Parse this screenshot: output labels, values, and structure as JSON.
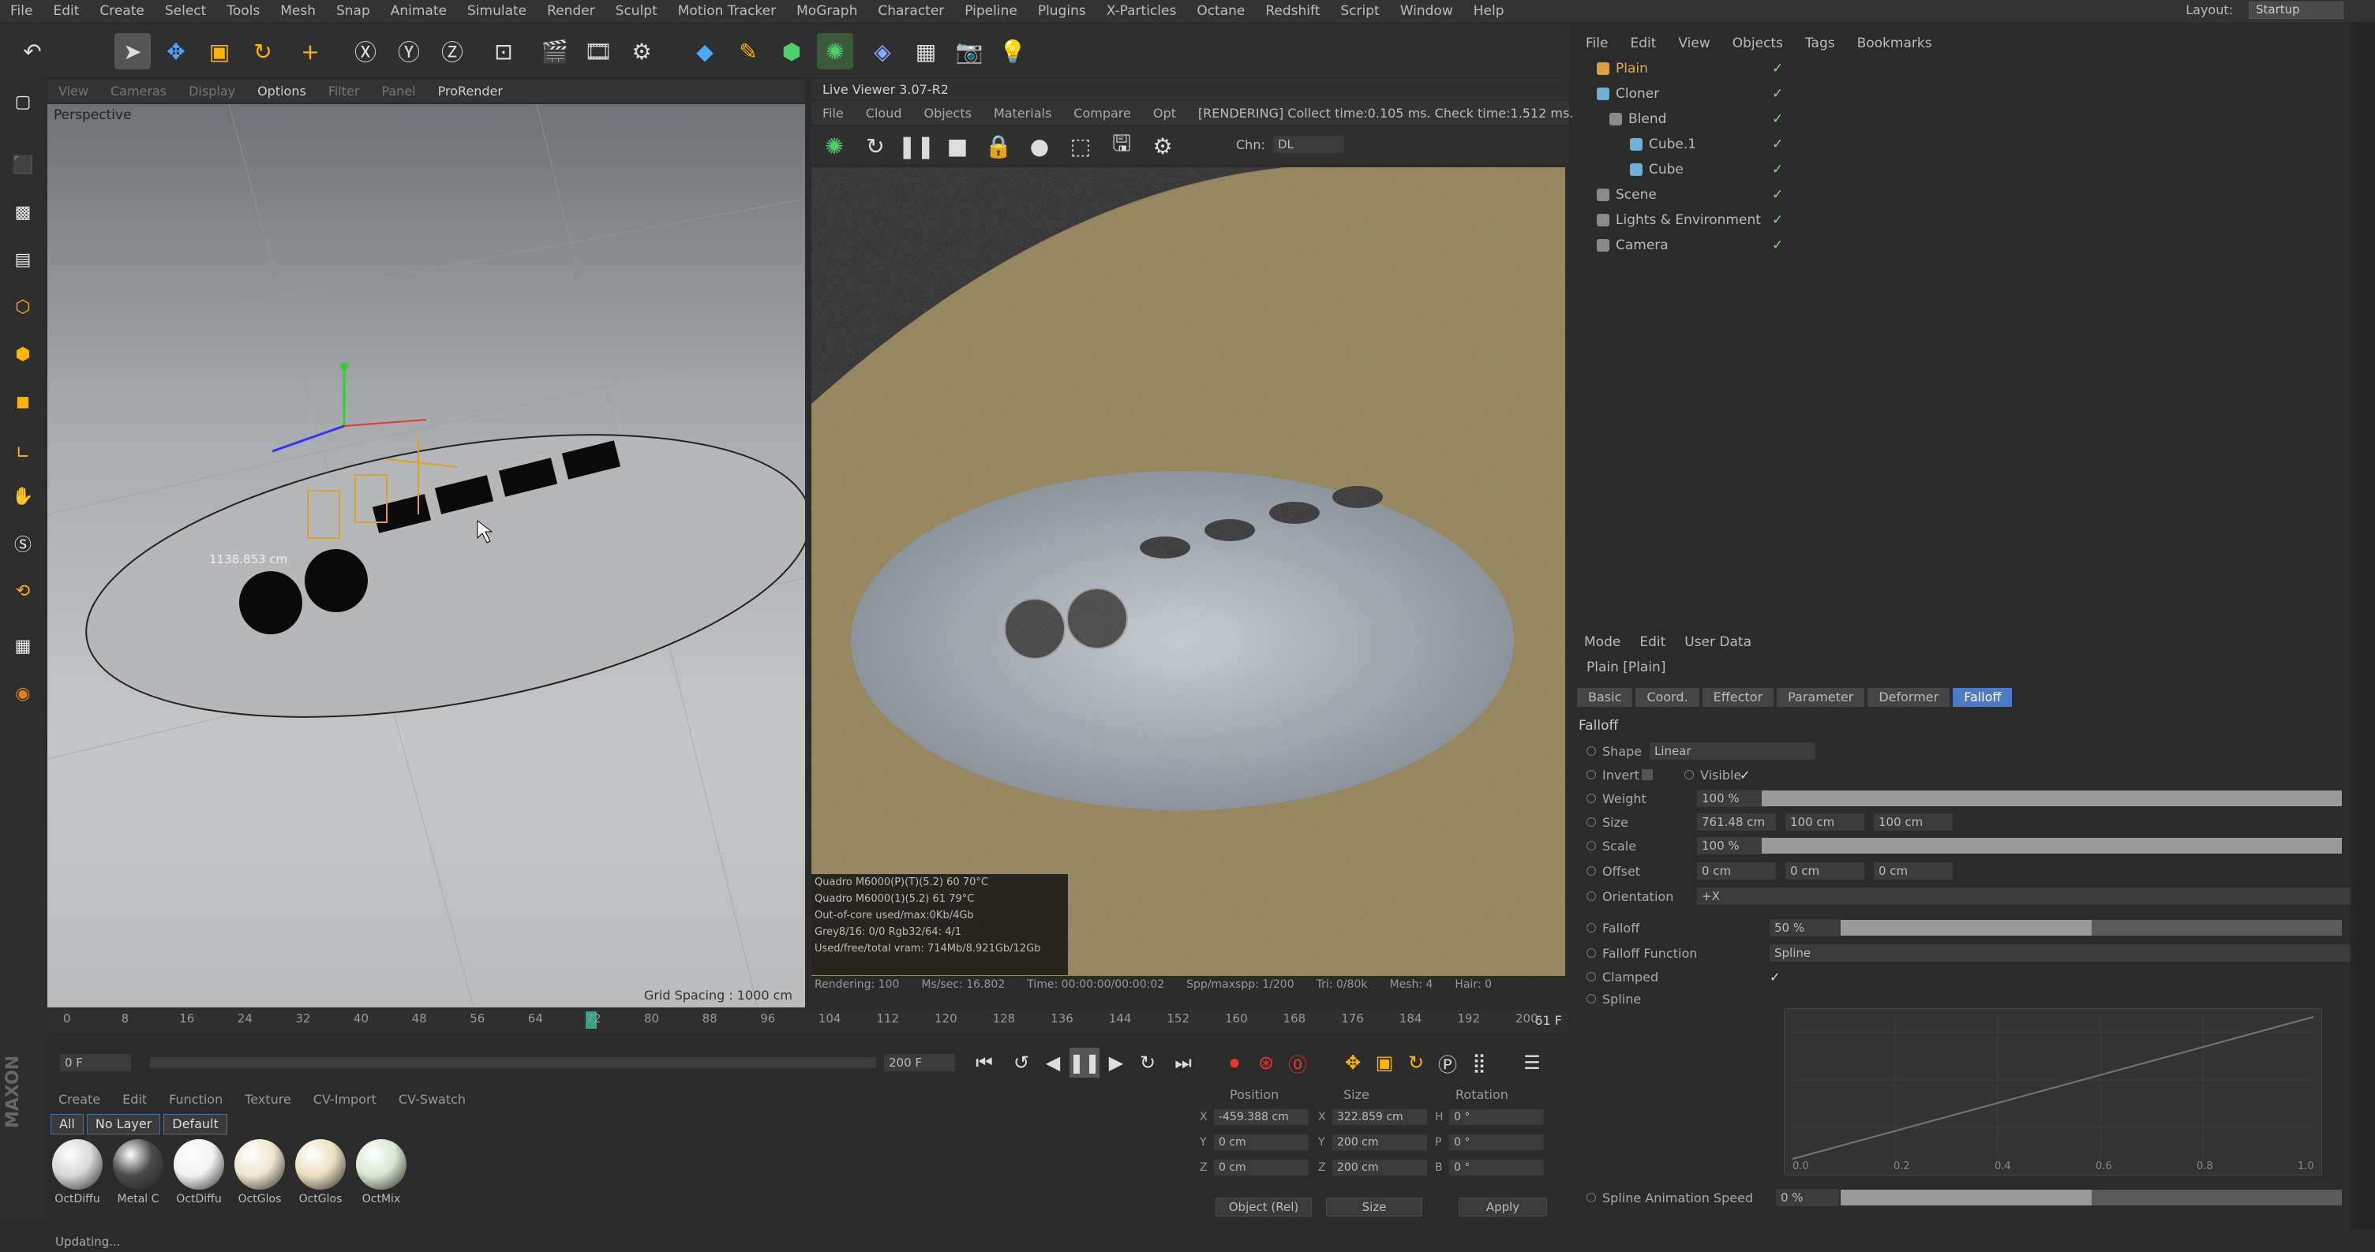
{
  "menubar": [
    "File",
    "Edit",
    "Create",
    "Select",
    "Tools",
    "Mesh",
    "Snap",
    "Animate",
    "Simulate",
    "Render",
    "Sculpt",
    "Motion Tracker",
    "MoGraph",
    "Character",
    "Pipeline",
    "Plugins",
    "X-Particles",
    "Octane",
    "Redshift",
    "Script",
    "Window",
    "Help"
  ],
  "layout": {
    "label": "Layout:",
    "value": "Startup"
  },
  "viewport": {
    "menu": [
      "View",
      "Cameras",
      "Display",
      "Options",
      "Filter",
      "Panel",
      "ProRender"
    ],
    "label": "Perspective",
    "grid_spacing": "Grid Spacing : 1000 cm",
    "dimension_readout": "1138.853 cm"
  },
  "live_viewer": {
    "title": "Live Viewer 3.07-R2",
    "menu": [
      "File",
      "Cloud",
      "Objects",
      "Materials",
      "Compare",
      "Opt"
    ],
    "render_status": "[RENDERING] Collect time:0.105 ms. Check time:1.512 ms.",
    "channel_label": "Chn:",
    "channel_value": "DL",
    "stats": [
      "Quadro M6000(P)(T)(5.2)    60    70°C",
      "Quadro M6000(1)(5.2)       61    79°C",
      "Out-of-core used/max:0Kb/4Gb",
      "Grey8/16: 0/0          Rgb32/64: 4/1",
      "Used/free/total vram: 714Mb/8.921Gb/12Gb"
    ],
    "status": [
      "Rendering: 100",
      "Ms/sec: 16.802",
      "Time: 00:00:00/00:00:02",
      "Spp/maxspp: 1/200",
      "Tri: 0/80k",
      "Mesh: 4",
      "Hair: 0"
    ]
  },
  "timeline": {
    "ticks": [
      "0",
      "8",
      "16",
      "24",
      "32",
      "40",
      "48",
      "56",
      "64",
      "72",
      "80",
      "88",
      "96",
      "104",
      "112",
      "120",
      "128",
      "136",
      "144",
      "152",
      "160",
      "168",
      "176",
      "184",
      "192",
      "200"
    ],
    "current_frame": "61 F",
    "playhead": 72,
    "start_field": "0 F",
    "end_field": "200 F"
  },
  "materials": {
    "menu": [
      "Create",
      "Edit",
      "Function",
      "Texture",
      "CV-Import",
      "CV-Swatch"
    ],
    "filters": [
      "All",
      "No Layer",
      "Default"
    ],
    "items": [
      {
        "label": "OctDiffu",
        "color": "#d8d8d8"
      },
      {
        "label": "Metal C",
        "color": "#4a4a4a"
      },
      {
        "label": "OctDiffu",
        "color": "#f2f2f2"
      },
      {
        "label": "OctGlos",
        "color": "#f0e6cf"
      },
      {
        "label": "OctGlos",
        "color": "#ece0c0"
      },
      {
        "label": "OctMix",
        "color": "#d8e8d0"
      }
    ]
  },
  "coordinates": {
    "headers": [
      "Position",
      "Size",
      "Rotation"
    ],
    "rows": [
      {
        "axis": "X",
        "pos": "-459.388 cm",
        "size_axis": "X",
        "size": "322.859 cm",
        "rot_axis": "H",
        "rot": "0 °"
      },
      {
        "axis": "Y",
        "pos": "0 cm",
        "size_axis": "Y",
        "size": "200 cm",
        "rot_axis": "P",
        "rot": "0 °"
      },
      {
        "axis": "Z",
        "pos": "0 cm",
        "size_axis": "Z",
        "size": "200 cm",
        "rot_axis": "B",
        "rot": "0 °"
      }
    ],
    "mode": "Object (Rel)",
    "size_mode": "Size",
    "apply": "Apply"
  },
  "object_manager": {
    "menu": [
      "File",
      "Edit",
      "View",
      "Objects",
      "Tags",
      "Bookmarks"
    ],
    "objects": [
      {
        "name": "Plain",
        "color": "#e0a040",
        "highlight": true
      },
      {
        "name": "Cloner",
        "color": "#6fb0d8",
        "highlight": false
      },
      {
        "name": "Blend",
        "color": "#8a8a8a",
        "highlight": false
      },
      {
        "name": "Cube.1",
        "color": "#6fb0d8",
        "highlight": false
      },
      {
        "name": "Cube",
        "color": "#6fb0d8",
        "highlight": false
      },
      {
        "name": "Scene",
        "color": "#8a8a8a",
        "highlight": false
      },
      {
        "name": "Lights & Environment",
        "color": "#8a8a8a",
        "highlight": false
      },
      {
        "name": "Camera",
        "color": "#8a8a8a",
        "highlight": false
      }
    ]
  },
  "attributes": {
    "menu": [
      "Mode",
      "Edit",
      "User Data"
    ],
    "title": "Plain [Plain]",
    "tabs": [
      "Basic",
      "Coord.",
      "Effector",
      "Parameter",
      "Deformer",
      "Falloff"
    ],
    "active_tab": "Falloff",
    "section": "Falloff",
    "shape_label": "Shape",
    "shape_value": "Linear",
    "invert_label": "Invert",
    "visible_label": "Visible",
    "weight_label": "Weight",
    "weight_value": "100 %",
    "size_label": "Size",
    "size_values": [
      "761.48 cm",
      "100 cm",
      "100 cm"
    ],
    "scale_label": "Scale",
    "scale_value": "100 %",
    "offset_label": "Offset",
    "offset_values": [
      "0 cm",
      "0 cm",
      "0 cm"
    ],
    "orientation_label": "Orientation",
    "orientation_value": "+X",
    "falloff_label": "Falloff",
    "falloff_value": "50 %",
    "falloff_fraction": 0.5,
    "falloff_function_label": "Falloff Function",
    "falloff_function_value": "Spline",
    "clamped_label": "Clamped",
    "spline_label": "Spline",
    "spline_axis": [
      "0.0",
      "0.2",
      "0.4",
      "0.6",
      "0.8",
      "1.0"
    ],
    "spline_speed_label": "Spline Animation Speed",
    "spline_speed_value": "0 %",
    "spline_speed_fraction": 0.5
  },
  "statusbar": "Updating..."
}
